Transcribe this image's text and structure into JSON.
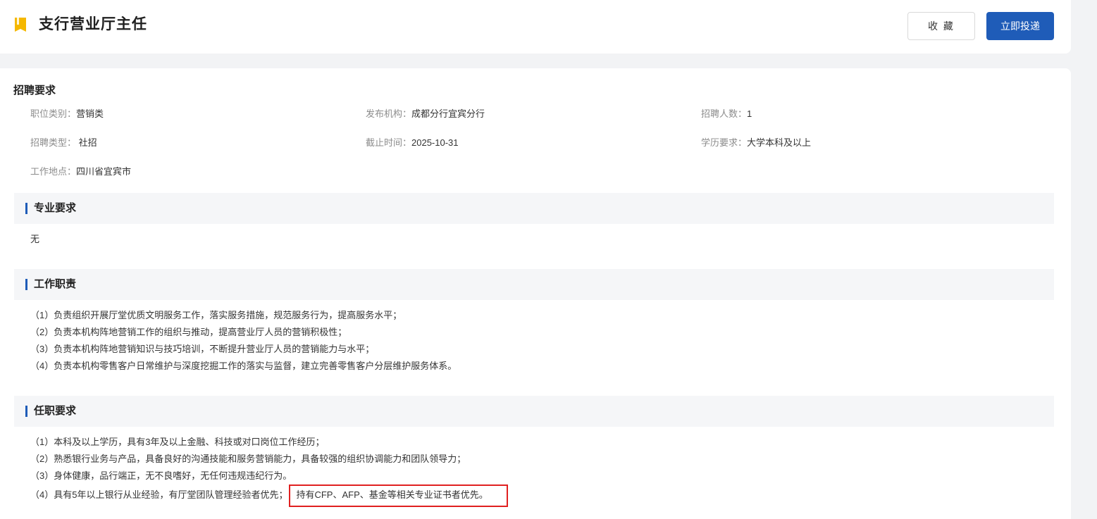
{
  "header": {
    "title": "支行营业厅主任",
    "favorite_label": "收 藏",
    "apply_label": "立即投递",
    "icon": "bookmark-icon"
  },
  "requirements": {
    "heading": "招聘要求",
    "fields": [
      {
        "label": "职位类别：",
        "value": "营销类"
      },
      {
        "label": "发布机构：",
        "value": "成都分行宜宾分行"
      },
      {
        "label": "招聘人数：",
        "value": "1"
      },
      {
        "label": "招聘类型：",
        "value": " 社招"
      },
      {
        "label": "截止时间：",
        "value": "2025-10-31"
      },
      {
        "label": "学历要求：",
        "value": "大学本科及以上"
      },
      {
        "label": "工作地点：",
        "value": "四川省宜宾市"
      }
    ]
  },
  "major": {
    "title": "专业要求",
    "content": "无"
  },
  "duties": {
    "title": "工作职责",
    "items": [
      "（1）负责组织开展厅堂优质文明服务工作，落实服务措施，规范服务行为，提高服务水平；",
      "（2）负责本机构阵地营销工作的组织与推动，提高营业厅人员的营销积极性；",
      "（3）负责本机构阵地营销知识与技巧培训，不断提升营业厅人员的营销能力与水平；",
      "（4）负责本机构零售客户日常维护与深度挖掘工作的落实与监督，建立完善零售客户分层维护服务体系。"
    ]
  },
  "qualifications": {
    "title": "任职要求",
    "items": [
      "（1）本科及以上学历，具有3年及以上金融、科技或对口岗位工作经历；",
      "（2）熟悉银行业务与产品，具备良好的沟通技能和服务营销能力，具备较强的组织协调能力和团队领导力；",
      "（3）身体健康，品行端正，无不良嗜好，无任何违规违纪行为。"
    ],
    "item4_prefix": "（4）具有5年以上银行从业经验，有厅堂团队管理经验者优先；",
    "item4_highlight": "持有CFP、AFP、基金等相关专业证书者优先。"
  },
  "colors": {
    "primary": "#1f5cb8",
    "highlight_border": "#e02020",
    "bookmark": "#f5b800"
  }
}
